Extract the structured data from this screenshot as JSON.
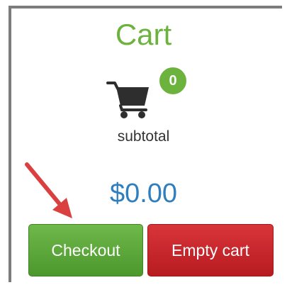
{
  "cart": {
    "title": "Cart",
    "icon": "shopping-cart-icon",
    "item_count": "0",
    "subtotal_label": "subtotal",
    "subtotal_value": "$0.00"
  },
  "buttons": {
    "checkout_label": "Checkout",
    "empty_cart_label": "Empty cart"
  },
  "annotation": {
    "icon": "arrow-icon"
  },
  "colors": {
    "title": "#6cb33e",
    "badge": "#6cb33e",
    "amount": "#2f7fbf",
    "checkout": "#5aa83b",
    "empty_cart": "#c9282d",
    "arrow": "#d9403f"
  }
}
